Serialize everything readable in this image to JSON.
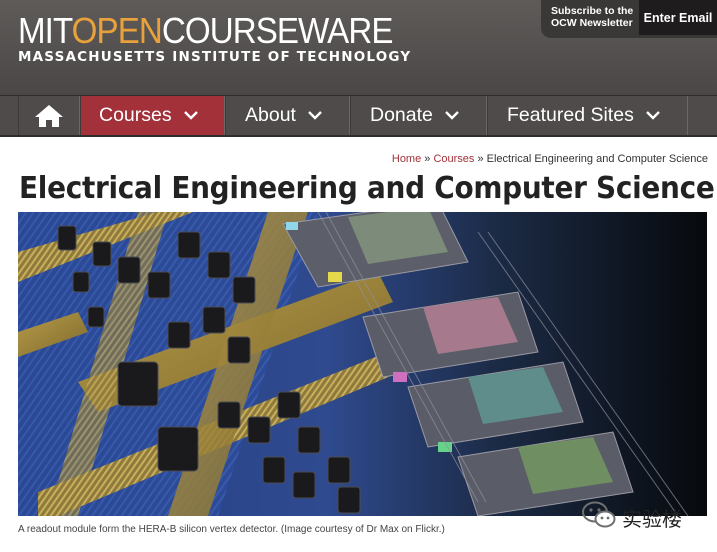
{
  "header": {
    "logo": {
      "mit": "MIT",
      "open": "OPEN",
      "courseware": "COURSEWARE",
      "subtitle": "MASSACHUSETTS INSTITUTE OF TECHNOLOGY"
    },
    "newsletter": {
      "text": "Subscribe to the OCW Newsletter",
      "button": "Enter Email"
    }
  },
  "nav": {
    "home_icon": "home-icon",
    "items": [
      {
        "label": "Courses",
        "active": true
      },
      {
        "label": "About",
        "active": false
      },
      {
        "label": "Donate",
        "active": false
      },
      {
        "label": "Featured Sites",
        "active": false
      }
    ]
  },
  "breadcrumb": {
    "home": "Home",
    "sep1": " » ",
    "courses": "Courses",
    "sep2": " » ",
    "current": "Electrical Engineering and Computer Science"
  },
  "page": {
    "title": "Electrical Engineering and Computer Science",
    "caption": "A readout module form the HERA-B silicon vertex detector. (Image courtesy of Dr Max on Flickr.)"
  },
  "watermark": {
    "text": "实验楼",
    "icon": "wechat-icon"
  },
  "colors": {
    "accent": "#a3313a",
    "header_bg": "#5a5756",
    "logo_orange": "#e9a23b"
  }
}
